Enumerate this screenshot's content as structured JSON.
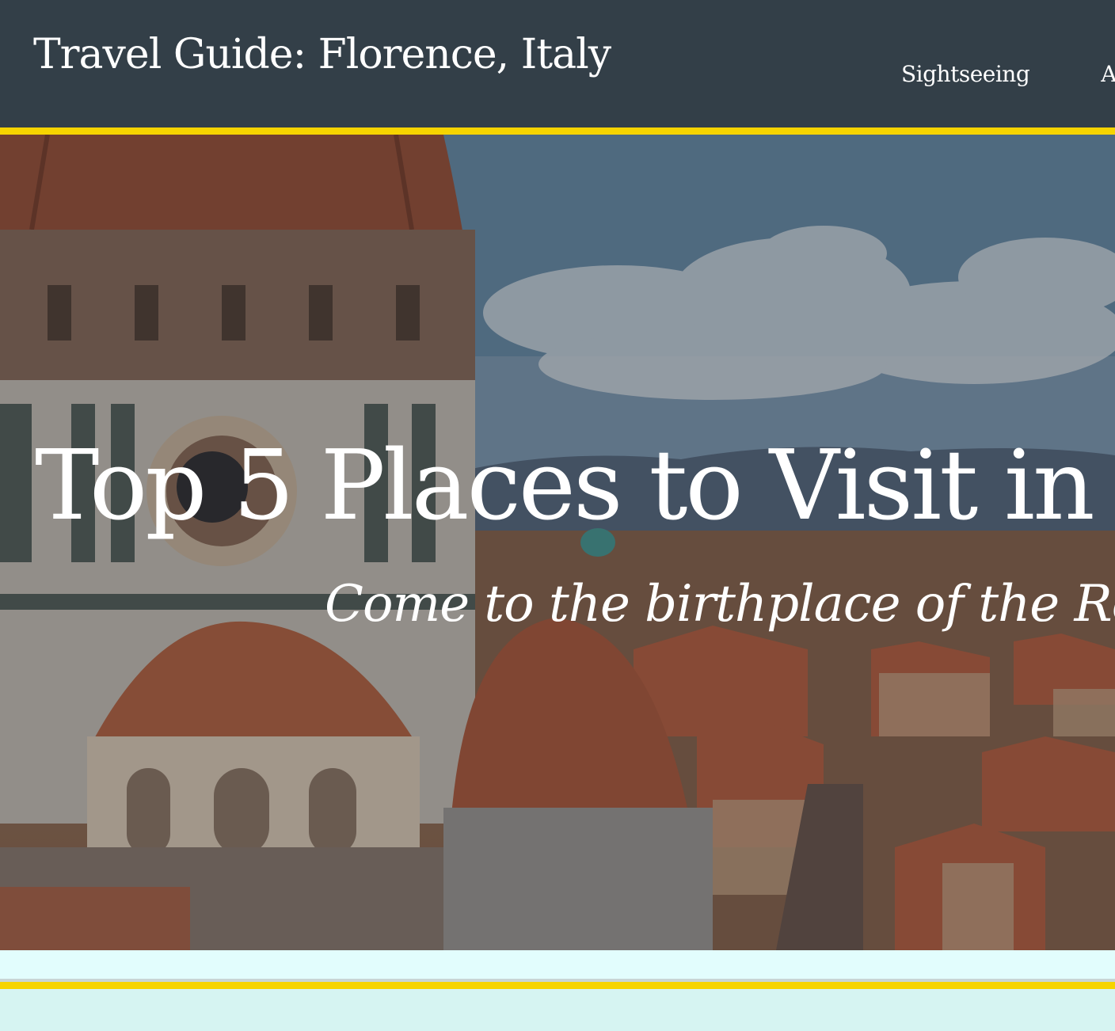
{
  "header": {
    "title": "Travel Guide: Florence, Italy",
    "nav": [
      {
        "label": "Sightseeing"
      },
      {
        "label": "Ar"
      }
    ],
    "background_color": "#333f48",
    "accent_color": "#f6d400"
  },
  "hero": {
    "title": "Top 5 Places to Visit in",
    "subtitle": "Come to the birthplace of the Re",
    "image": "florence-duomo-cityscape-photo"
  },
  "page": {
    "band_color": "#e2fdfd",
    "footer_color": "#d6f4f2"
  }
}
